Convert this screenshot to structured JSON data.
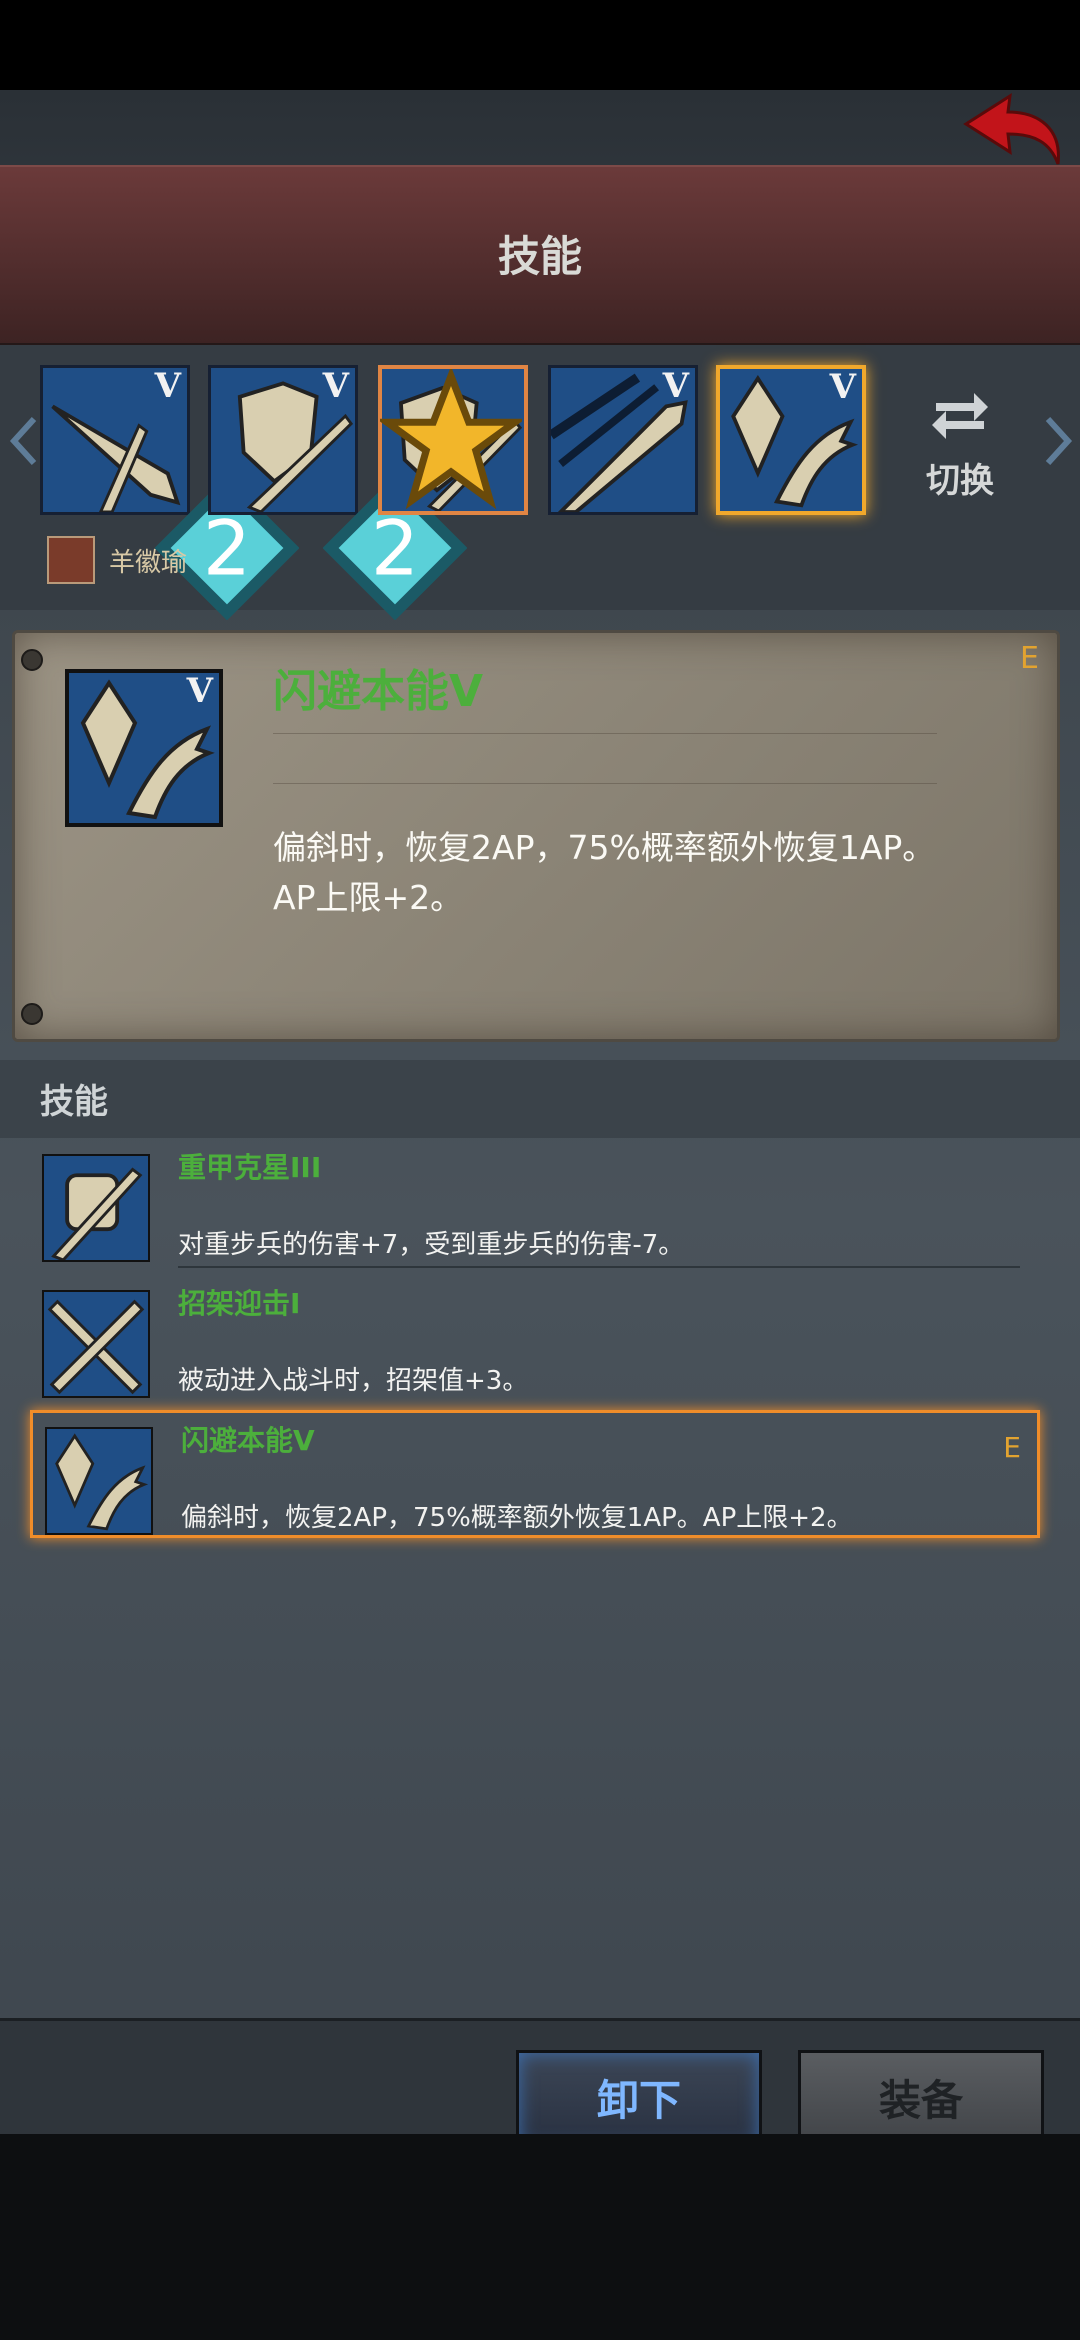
{
  "header": {
    "title": "技能"
  },
  "skill_slots": [
    {
      "name": "blade-strike",
      "level": "V",
      "gem": "2"
    },
    {
      "name": "shield-parry",
      "level": "V",
      "gem": "2"
    },
    {
      "name": "shield-sword",
      "level": ""
    },
    {
      "name": "slash",
      "level": "V"
    },
    {
      "name": "evade-instinct",
      "level": "V"
    }
  ],
  "switch": {
    "label": "切换"
  },
  "character": {
    "name": "羊徽瑜"
  },
  "detail": {
    "title": "闪避本能V",
    "grade": "E",
    "level": "V",
    "description_line1": "偏斜时，恢复2AP，75%概率额外恢复1AP。",
    "description_line2": "AP上限+2。"
  },
  "skills_section": {
    "label": "技能",
    "items": [
      {
        "name": "重甲克星III",
        "description": "对重步兵的伤害+7，受到重步兵的伤害-7。",
        "grade": ""
      },
      {
        "name": "招架迎击I",
        "description": "被动进入战斗时，招架值+3。",
        "grade": ""
      },
      {
        "name": "闪避本能V",
        "description": "偏斜时，恢复2AP，75%概率额外恢复1AP。AP上限+2。",
        "grade": "E"
      }
    ]
  },
  "buttons": {
    "unequip": "卸下",
    "equip": "装备"
  }
}
